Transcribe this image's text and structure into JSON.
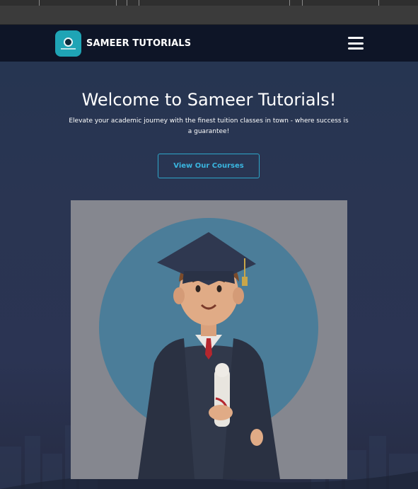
{
  "navbar": {
    "brand_name": "SAMEER TUTORIALS",
    "logo_icon": "school-logo-icon",
    "menu_icon": "hamburger-menu-icon"
  },
  "hero": {
    "title": "Welcome to Sameer Tutorials!",
    "subtitle": "Elevate your academic journey with the finest tuition classes in town - where success is a guarantee!",
    "cta_label": "View Our Courses",
    "illustration": "graduate-student-illustration"
  },
  "colors": {
    "navbar_bg": "#0e1527",
    "hero_bg": "#263551",
    "accent": "#2ea6c9",
    "logo_bg": "#1fa4b5"
  }
}
